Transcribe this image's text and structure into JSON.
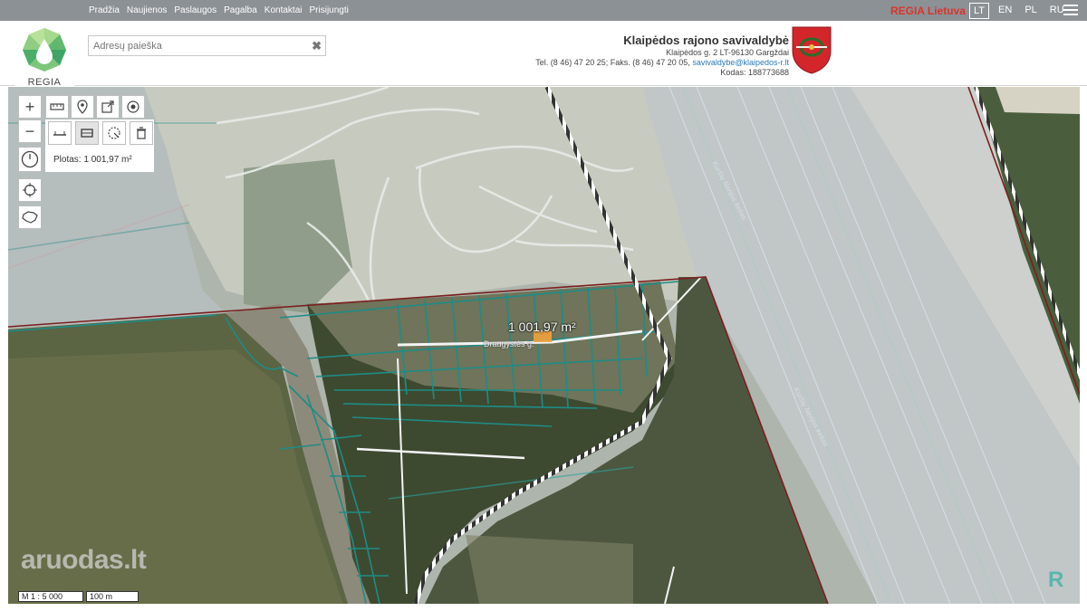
{
  "top_nav": [
    "Pradžia",
    "Naujienos",
    "Paslaugos",
    "Pagalba",
    "Kontaktai",
    "Prisijungti"
  ],
  "brand_right": "REGIA Lietuva",
  "languages": [
    {
      "code": "LT",
      "active": true
    },
    {
      "code": "EN",
      "active": false
    },
    {
      "code": "PL",
      "active": false
    },
    {
      "code": "RU",
      "active": false
    }
  ],
  "logo": {
    "text": "REGIA"
  },
  "search": {
    "placeholder": "Adresų paieška",
    "value": ""
  },
  "municipality": {
    "name": "Klaipėdos rajono savivaldybė",
    "address": "Klaipėdos g. 2 LT-96130 Gargždai",
    "phone": "Tel. (8 46) 47 20 25; Faks. (8 46) 47 20 05,",
    "email": "savivaldybe@klaipedos-r.lt",
    "code": "Kodas: 188773688"
  },
  "map": {
    "area_label": "Plotas: 1 001,97 m²",
    "measurement": "1 001,97 m²",
    "street": "Draugystės g.",
    "road_label_1": "Kuršių Nerijos kelias",
    "road_label_2": "Kuršių Nerijos kelias",
    "scale": "M 1 : 5 000",
    "scale_distance": "100 m",
    "watermark": "aruodas.lt"
  },
  "tools": {
    "zoom_in": "+",
    "zoom_out": "−"
  },
  "colors": {
    "topbar": "#8c9195",
    "brand_red": "#d9342b",
    "parcel_lines": "#1e8c86",
    "boundary": "#7a1f1f"
  }
}
